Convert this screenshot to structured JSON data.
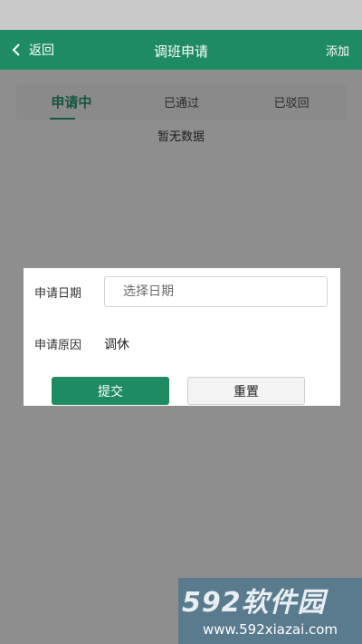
{
  "header": {
    "back_label": "返回",
    "title": "调班申请",
    "add_label": "添加"
  },
  "tabs": [
    {
      "label": "申请中",
      "active": true
    },
    {
      "label": "已通过",
      "active": false
    },
    {
      "label": "已驳回",
      "active": false
    }
  ],
  "list": {
    "empty_message": "暂无数据"
  },
  "dialog": {
    "date_label": "申请日期",
    "date_placeholder": "选择日期",
    "reason_label": "申请原因",
    "reason_value": "调休",
    "submit_label": "提交",
    "reset_label": "重置"
  },
  "watermark": {
    "logo": "592软件园",
    "url": "www.592xiazai.com"
  },
  "colors": {
    "primary": "#1f8b63",
    "overlay": "#8e8e8e"
  }
}
